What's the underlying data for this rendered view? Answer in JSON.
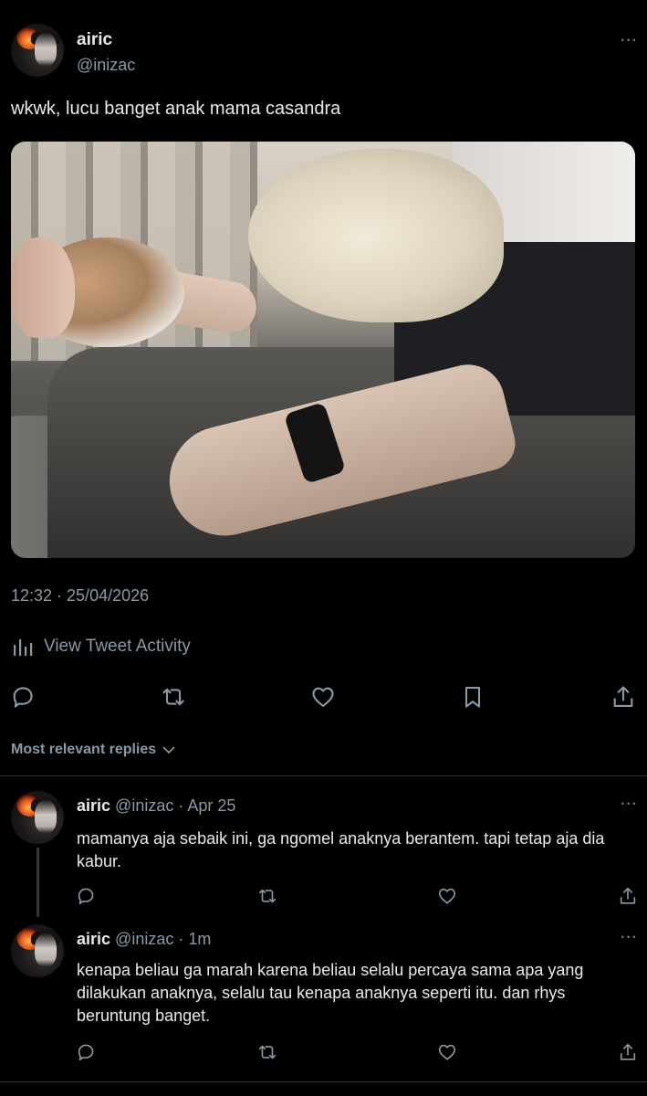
{
  "tweet": {
    "author_name": "airic",
    "author_handle": "@inizac",
    "more_label": "···",
    "text": "wkwk, lucu banget anak mama casandra",
    "timestamp": "12:32 · 25/04/2026",
    "activity_label": "View Tweet Activity",
    "actions": [
      "reply-icon",
      "retweet-icon",
      "like-icon",
      "bookmark-icon",
      "share-icon"
    ]
  },
  "replies_sort": {
    "label": "Most relevant replies"
  },
  "replies": [
    {
      "name": "airic",
      "meta": "@inizac · Apr 25",
      "more_label": "···",
      "text": "mamanya aja sebaik ini, ga ngomel anaknya berantem. tapi tetap aja dia kabur."
    },
    {
      "name": "airic",
      "meta": "@inizac · 1m",
      "more_label": "···",
      "text": "kenapa beliau ga marah karena beliau selalu percaya sama apa yang dilakukan anaknya, selalu tau kenapa anaknya seperti itu. dan rhys beruntung banget."
    }
  ],
  "colors": {
    "background": "#000000",
    "text_primary": "#e7e9ea",
    "text_secondary": "#8b98a5",
    "divider": "#2f3336"
  }
}
